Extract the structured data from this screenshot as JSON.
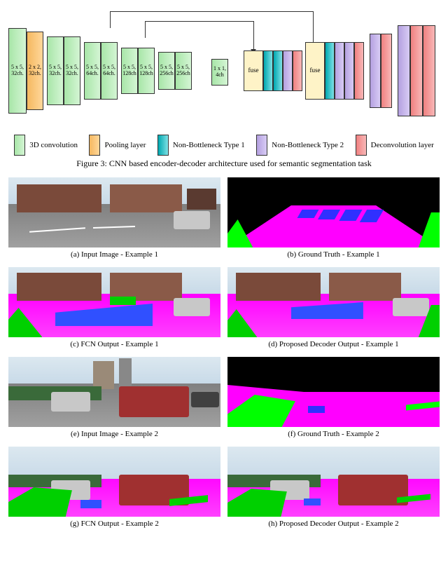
{
  "diagram": {
    "encoder": [
      {
        "label1": "5 x 5,",
        "label2": "32ch."
      },
      {
        "label1": "2 x 2,",
        "label2": "32ch."
      },
      {
        "label1": "5 x 5,",
        "label2": "32ch."
      },
      {
        "label1": "5 x 5,",
        "label2": "32ch."
      },
      {
        "label1": "5 x 5,",
        "label2": "64ch."
      },
      {
        "label1": "5 x 5,",
        "label2": "64ch."
      },
      {
        "label1": "5 x 5,",
        "label2": "128ch"
      },
      {
        "label1": "5 x 5,",
        "label2": "128ch"
      },
      {
        "label1": "5 x 5,",
        "label2": "256ch"
      },
      {
        "label1": "5 x 5,",
        "label2": "256ch"
      }
    ],
    "mid": {
      "label1": "1 x 1,",
      "label2": "4ch"
    },
    "fuse_label": "fuse"
  },
  "legend": {
    "conv3d": "3D convolution",
    "pool": "Pooling layer",
    "nb1": "Non-Bottleneck Type 1",
    "nb2": "Non-Bottleneck Type 2",
    "deconv": "Deconvolution layer"
  },
  "figure_caption": "Figure 3: CNN based encoder-decoder architecture used for semantic segmentation task",
  "panels": {
    "a": "(a) Input Image - Example 1",
    "b": "(b) Ground Truth - Example 1",
    "c": "(c) FCN Output - Example 1",
    "d": "(d) Proposed Decoder Output - Example 1",
    "e": "(e) Input Image - Example 2",
    "f": "(f) Ground Truth - Example 2",
    "g": "(g) FCN Output - Example 2",
    "h": "(h) Proposed Decoder Output - Example 2"
  }
}
